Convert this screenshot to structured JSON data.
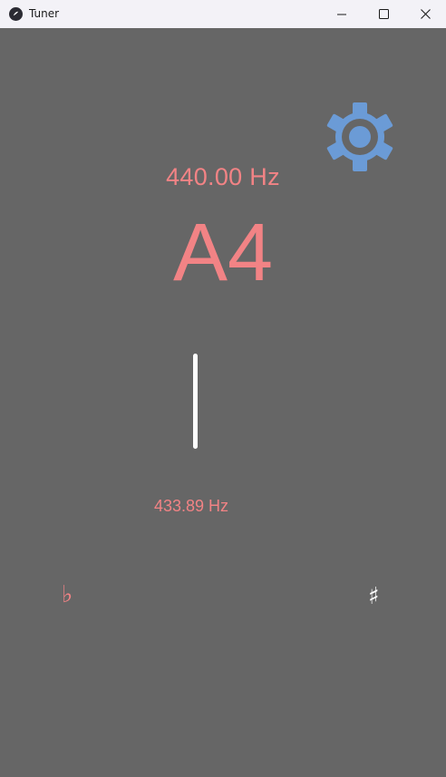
{
  "window": {
    "title": "Tuner",
    "controls": [
      "minimize",
      "maximize",
      "close"
    ]
  },
  "tuner": {
    "target_frequency": "440.00 Hz",
    "note": "A4",
    "detected_frequency": "433.89 Hz",
    "flat_symbol": "♭",
    "sharp_symbol": "♯"
  },
  "icons": {
    "app": "kivy-logo-icon",
    "settings": "gear-icon"
  },
  "colors": {
    "background": "#666666",
    "titlebar": "#f3f2f7",
    "text_accent": "#f28385",
    "settings_icon": "#6b9bd6",
    "needle": "#ffffff",
    "sharp": "#ffffff"
  }
}
